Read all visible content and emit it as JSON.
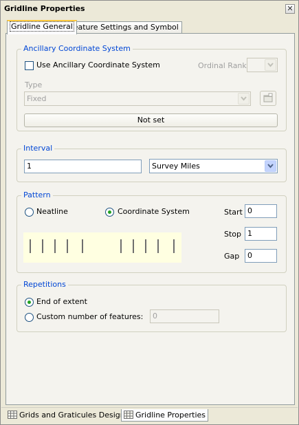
{
  "window": {
    "title": "Gridline Properties",
    "close_glyph": "✕"
  },
  "tabs": [
    {
      "label": "Gridline General",
      "active": true
    },
    {
      "label": "Feature Settings and Symbol",
      "active": false
    }
  ],
  "ancillary": {
    "legend": "Ancillary Coordinate System",
    "use_checkbox_label": "Use Ancillary Coordinate System",
    "use_checked": false,
    "ordinal_rank_label": "Ordinal Rank:",
    "ordinal_rank_value": "",
    "type_label": "Type",
    "type_value": "Fixed",
    "not_set_button": "Not set",
    "properties_icon": "properties-icon"
  },
  "interval": {
    "legend": "Interval",
    "value": "1",
    "units": "Survey Miles"
  },
  "pattern": {
    "legend": "Pattern",
    "neatline_label": "Neatline",
    "neatline_selected": false,
    "coordinate_system_label": "Coordinate System",
    "coordinate_system_selected": true,
    "start_label": "Start",
    "start_value": "0",
    "stop_label": "Stop",
    "stop_value": "1",
    "gap_label": "Gap",
    "gap_value": "0",
    "preview_bg": "#ffffe1"
  },
  "repetitions": {
    "legend": "Repetitions",
    "end_of_extent_label": "End of extent",
    "end_of_extent_selected": true,
    "custom_label": "Custom number of features:",
    "custom_selected": false,
    "custom_value": "0"
  },
  "bottom_tabs": [
    {
      "label": "Grids and Graticules Designer",
      "active": false,
      "icon": "grid-designer-icon"
    },
    {
      "label": "Gridline Properties",
      "active": true,
      "icon": "gridline-properties-icon"
    }
  ],
  "colors": {
    "group_legend": "#0046d5",
    "active_tab_accent": "#ffc83c",
    "radio_dot": "#21a121"
  }
}
